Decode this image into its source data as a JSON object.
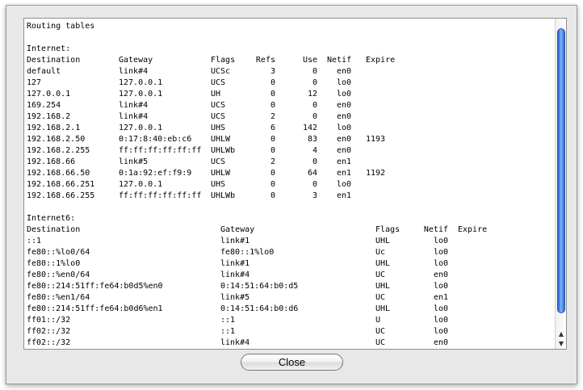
{
  "dialog": {
    "close_label": "Close"
  },
  "output": {
    "title": "Routing tables",
    "ipv4": {
      "label": "Internet:",
      "headers": {
        "destination": "Destination",
        "gateway": "Gateway",
        "flags": "Flags",
        "refs": "Refs",
        "use": "Use",
        "netif": "Netif",
        "expire": "Expire"
      },
      "rows": [
        {
          "destination": "default",
          "gateway": "link#4",
          "flags": "UCSc",
          "refs": "3",
          "use": "0",
          "netif": "en0",
          "expire": ""
        },
        {
          "destination": "127",
          "gateway": "127.0.0.1",
          "flags": "UCS",
          "refs": "0",
          "use": "0",
          "netif": "lo0",
          "expire": ""
        },
        {
          "destination": "127.0.0.1",
          "gateway": "127.0.0.1",
          "flags": "UH",
          "refs": "0",
          "use": "12",
          "netif": "lo0",
          "expire": ""
        },
        {
          "destination": "169.254",
          "gateway": "link#4",
          "flags": "UCS",
          "refs": "0",
          "use": "0",
          "netif": "en0",
          "expire": ""
        },
        {
          "destination": "192.168.2",
          "gateway": "link#4",
          "flags": "UCS",
          "refs": "2",
          "use": "0",
          "netif": "en0",
          "expire": ""
        },
        {
          "destination": "192.168.2.1",
          "gateway": "127.0.0.1",
          "flags": "UHS",
          "refs": "6",
          "use": "142",
          "netif": "lo0",
          "expire": ""
        },
        {
          "destination": "192.168.2.50",
          "gateway": "0:17:8:40:eb:c6",
          "flags": "UHLW",
          "refs": "0",
          "use": "83",
          "netif": "en0",
          "expire": "1193"
        },
        {
          "destination": "192.168.2.255",
          "gateway": "ff:ff:ff:ff:ff:ff",
          "flags": "UHLWb",
          "refs": "0",
          "use": "4",
          "netif": "en0",
          "expire": ""
        },
        {
          "destination": "192.168.66",
          "gateway": "link#5",
          "flags": "UCS",
          "refs": "2",
          "use": "0",
          "netif": "en1",
          "expire": ""
        },
        {
          "destination": "192.168.66.50",
          "gateway": "0:1a:92:ef:f9:9",
          "flags": "UHLW",
          "refs": "0",
          "use": "64",
          "netif": "en1",
          "expire": "1192"
        },
        {
          "destination": "192.168.66.251",
          "gateway": "127.0.0.1",
          "flags": "UHS",
          "refs": "0",
          "use": "0",
          "netif": "lo0",
          "expire": ""
        },
        {
          "destination": "192.168.66.255",
          "gateway": "ff:ff:ff:ff:ff:ff",
          "flags": "UHLWb",
          "refs": "0",
          "use": "3",
          "netif": "en1",
          "expire": ""
        }
      ]
    },
    "ipv6": {
      "label": "Internet6:",
      "headers": {
        "destination": "Destination",
        "gateway": "Gateway",
        "flags": "Flags",
        "netif": "Netif",
        "expire": "Expire"
      },
      "rows": [
        {
          "destination": "::1",
          "gateway": "link#1",
          "flags": "UHL",
          "netif": "lo0"
        },
        {
          "destination": "fe80::%lo0/64",
          "gateway": "fe80::1%lo0",
          "flags": "Uc",
          "netif": "lo0"
        },
        {
          "destination": "fe80::1%lo0",
          "gateway": "link#1",
          "flags": "UHL",
          "netif": "lo0"
        },
        {
          "destination": "fe80::%en0/64",
          "gateway": "link#4",
          "flags": "UC",
          "netif": "en0"
        },
        {
          "destination": "fe80::214:51ff:fe64:b0d5%en0",
          "gateway": "0:14:51:64:b0:d5",
          "flags": "UHL",
          "netif": "lo0"
        },
        {
          "destination": "fe80::%en1/64",
          "gateway": "link#5",
          "flags": "UC",
          "netif": "en1"
        },
        {
          "destination": "fe80::214:51ff:fe64:b0d6%en1",
          "gateway": "0:14:51:64:b0:d6",
          "flags": "UHL",
          "netif": "lo0"
        },
        {
          "destination": "ff01::/32",
          "gateway": "::1",
          "flags": "U",
          "netif": "lo0"
        },
        {
          "destination": "ff02::/32",
          "gateway": "::1",
          "flags": "UC",
          "netif": "lo0"
        },
        {
          "destination": "ff02::/32",
          "gateway": "link#4",
          "flags": "UC",
          "netif": "en0"
        }
      ]
    }
  },
  "scrollbar": {
    "up_arrow_icon": "up-arrow-icon",
    "down_arrow_icon": "down-arrow-icon"
  }
}
